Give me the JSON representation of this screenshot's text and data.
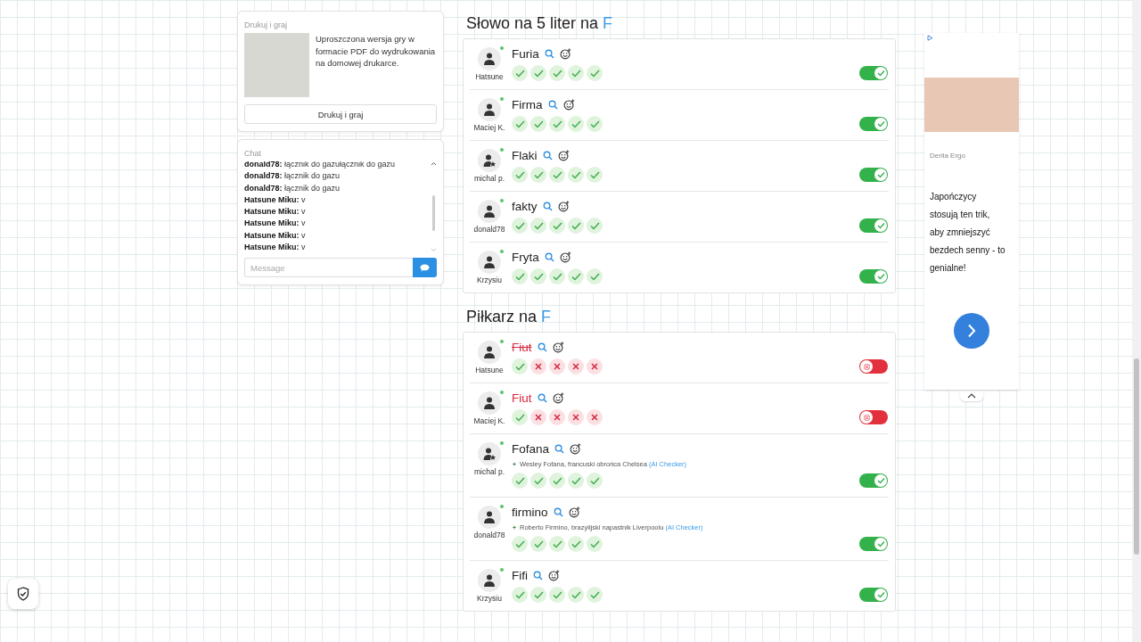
{
  "print_card": {
    "title": "Drukuj i graj",
    "description": "Uproszczona wersja gry w formacie PDF do wydrukowania na domowej drukarce.",
    "button": "Drukuj i graj"
  },
  "chat": {
    "title": "Chat",
    "messages": [
      {
        "user": "donald78:",
        "text": "łącznik do gazułącznik do gazu"
      },
      {
        "user": "donald78:",
        "text": "łącznik do gazu"
      },
      {
        "user": "donald78:",
        "text": "łącznik do gazu"
      },
      {
        "user": "Hatsune Miku:",
        "text": "v"
      },
      {
        "user": "Hatsune Miku:",
        "text": "v"
      },
      {
        "user": "Hatsune Miku:",
        "text": "v"
      },
      {
        "user": "Hatsune Miku:",
        "text": "v"
      },
      {
        "user": "Hatsune Miku:",
        "text": "v"
      }
    ],
    "placeholder": "Message"
  },
  "sections": [
    {
      "title": "Słowo na 5 liter na",
      "letter": "F",
      "entries": [
        {
          "word": "Furia",
          "user": "Hatsune",
          "kind": "plain",
          "struck": false,
          "votes": [
            true,
            true,
            true,
            true,
            true
          ],
          "accepted": true
        },
        {
          "word": "Firma",
          "user": "Maciej K.",
          "kind": "plain",
          "struck": false,
          "votes": [
            true,
            true,
            true,
            true,
            true
          ],
          "accepted": true
        },
        {
          "word": "Flaki",
          "user": "michal p.",
          "kind": "star",
          "struck": false,
          "votes": [
            true,
            true,
            true,
            true,
            true
          ],
          "accepted": true
        },
        {
          "word": "fakty",
          "user": "donald78",
          "kind": "plain",
          "struck": false,
          "votes": [
            true,
            true,
            true,
            true,
            true
          ],
          "accepted": true
        },
        {
          "word": "Fryta",
          "user": "Krzysiu",
          "kind": "plain",
          "struck": false,
          "votes": [
            true,
            true,
            true,
            true,
            true
          ],
          "accepted": true
        }
      ]
    },
    {
      "title": "Piłkarz na",
      "letter": "F",
      "entries": [
        {
          "word": "Fiut",
          "user": "Hatsune",
          "kind": "plain",
          "struck": true,
          "votes": [
            true,
            false,
            false,
            false,
            false
          ],
          "accepted": false
        },
        {
          "word": "Fiut",
          "user": "Maciej K.",
          "kind": "plain",
          "struck": false,
          "votes": [
            true,
            false,
            false,
            false,
            false
          ],
          "accepted": false
        },
        {
          "word": "Fofana",
          "user": "michal p.",
          "kind": "star",
          "struck": false,
          "note": "Wesley Fofana, francuski obrońca Chelsea",
          "note_source": "(AI Checker)",
          "votes": [
            true,
            true,
            true,
            true,
            true
          ],
          "accepted": true
        },
        {
          "word": "firmino",
          "user": "donald78",
          "kind": "plain",
          "struck": false,
          "note": "Roberto Firmino, brazylijski napastnik Liverpoolu",
          "note_source": "(AI Checker)",
          "votes": [
            true,
            true,
            true,
            true,
            true
          ],
          "accepted": true
        },
        {
          "word": "Fifi",
          "user": "Krzysiu",
          "kind": "plain",
          "struck": false,
          "votes": [
            true,
            true,
            true,
            true,
            true
          ],
          "accepted": true
        }
      ]
    }
  ],
  "ad": {
    "source": "Derila Ergo",
    "text": "Japończycy stosują ten trik, aby zmniejszyć bezdech senny - to genialne!"
  }
}
